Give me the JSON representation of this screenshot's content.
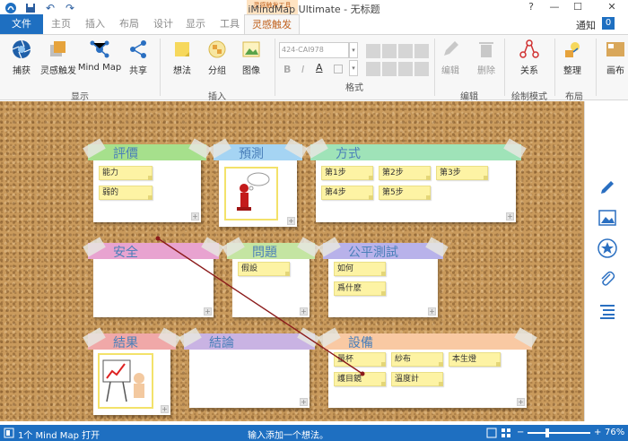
{
  "window": {
    "title": "iMindMap Ultimate - 无标题",
    "context_group": "灵感触发工具",
    "help": "?",
    "minimize": "—",
    "maximize": "☐",
    "close": "✕"
  },
  "tabs": [
    "文件",
    "主页",
    "插入",
    "布局",
    "设计",
    "显示",
    "工具",
    "灵感触发"
  ],
  "notifications": {
    "label": "通知",
    "count": "0"
  },
  "ribbon": {
    "display_group": "显示",
    "insert_group": "插入",
    "format_group": "格式",
    "edit_group": "编辑",
    "mode_group": "绘制模式",
    "layout_group": "布局",
    "buttons": {
      "capture": "捕获",
      "brainstorm": "灵感触发",
      "mindmap": "Mind Map",
      "share": "共享",
      "idea": "想法",
      "group": "分组",
      "image": "图像",
      "edit": "编辑",
      "delete": "删除",
      "relation": "关系",
      "organize": "整理",
      "canvas": "画布"
    },
    "font_name": "424-CAI978",
    "bold": "B",
    "italic": "I",
    "underline": "A"
  },
  "notes": [
    {
      "title": "評價",
      "items": [
        "能力",
        "弱的"
      ]
    },
    {
      "title": "預測",
      "items": []
    },
    {
      "title": "方式",
      "items": [
        "第1步",
        "第2步",
        "第3步",
        "第4步",
        "第5步"
      ]
    },
    {
      "title": "安全",
      "items": []
    },
    {
      "title": "問題",
      "items": [
        "假設"
      ]
    },
    {
      "title": "公平測試",
      "items": [
        "如何",
        "爲什麽"
      ]
    },
    {
      "title": "結果",
      "items": []
    },
    {
      "title": "結論",
      "items": []
    },
    {
      "title": "設備",
      "items": [
        "量杯",
        "紗布",
        "本生燈",
        "護目鏡",
        "溫度計"
      ]
    }
  ],
  "colors": {
    "note_bands": [
      "#a6e08c",
      "#a5d4f3",
      "#9fe3b8",
      "#e8a3d0",
      "#c4e5a2",
      "#b8b2ea",
      "#f0a8a8",
      "#c9b3e3",
      "#f9c9a3"
    ],
    "accent": "#1e6fc1",
    "context_tab": "#c0621e",
    "relation_line": "#8b1a1a"
  },
  "status": {
    "left": "1个 Mind Map 打开",
    "center": "输入添加一个想法。",
    "zoom": "76%"
  },
  "right_panel_icons": [
    "pen-icon",
    "image-icon",
    "star-icon",
    "paperclip-icon",
    "list-icon"
  ]
}
